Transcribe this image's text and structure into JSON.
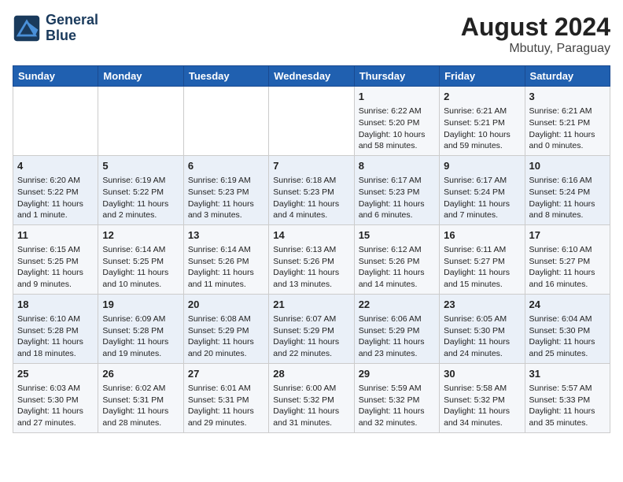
{
  "header": {
    "logo_line1": "General",
    "logo_line2": "Blue",
    "month_year": "August 2024",
    "location": "Mbutuy, Paraguay"
  },
  "days_of_week": [
    "Sunday",
    "Monday",
    "Tuesday",
    "Wednesday",
    "Thursday",
    "Friday",
    "Saturday"
  ],
  "weeks": [
    [
      {
        "day": "",
        "info": ""
      },
      {
        "day": "",
        "info": ""
      },
      {
        "day": "",
        "info": ""
      },
      {
        "day": "",
        "info": ""
      },
      {
        "day": "1",
        "info": "Sunrise: 6:22 AM\nSunset: 5:20 PM\nDaylight: 10 hours\nand 58 minutes."
      },
      {
        "day": "2",
        "info": "Sunrise: 6:21 AM\nSunset: 5:21 PM\nDaylight: 10 hours\nand 59 minutes."
      },
      {
        "day": "3",
        "info": "Sunrise: 6:21 AM\nSunset: 5:21 PM\nDaylight: 11 hours\nand 0 minutes."
      }
    ],
    [
      {
        "day": "4",
        "info": "Sunrise: 6:20 AM\nSunset: 5:22 PM\nDaylight: 11 hours\nand 1 minute."
      },
      {
        "day": "5",
        "info": "Sunrise: 6:19 AM\nSunset: 5:22 PM\nDaylight: 11 hours\nand 2 minutes."
      },
      {
        "day": "6",
        "info": "Sunrise: 6:19 AM\nSunset: 5:23 PM\nDaylight: 11 hours\nand 3 minutes."
      },
      {
        "day": "7",
        "info": "Sunrise: 6:18 AM\nSunset: 5:23 PM\nDaylight: 11 hours\nand 4 minutes."
      },
      {
        "day": "8",
        "info": "Sunrise: 6:17 AM\nSunset: 5:23 PM\nDaylight: 11 hours\nand 6 minutes."
      },
      {
        "day": "9",
        "info": "Sunrise: 6:17 AM\nSunset: 5:24 PM\nDaylight: 11 hours\nand 7 minutes."
      },
      {
        "day": "10",
        "info": "Sunrise: 6:16 AM\nSunset: 5:24 PM\nDaylight: 11 hours\nand 8 minutes."
      }
    ],
    [
      {
        "day": "11",
        "info": "Sunrise: 6:15 AM\nSunset: 5:25 PM\nDaylight: 11 hours\nand 9 minutes."
      },
      {
        "day": "12",
        "info": "Sunrise: 6:14 AM\nSunset: 5:25 PM\nDaylight: 11 hours\nand 10 minutes."
      },
      {
        "day": "13",
        "info": "Sunrise: 6:14 AM\nSunset: 5:26 PM\nDaylight: 11 hours\nand 11 minutes."
      },
      {
        "day": "14",
        "info": "Sunrise: 6:13 AM\nSunset: 5:26 PM\nDaylight: 11 hours\nand 13 minutes."
      },
      {
        "day": "15",
        "info": "Sunrise: 6:12 AM\nSunset: 5:26 PM\nDaylight: 11 hours\nand 14 minutes."
      },
      {
        "day": "16",
        "info": "Sunrise: 6:11 AM\nSunset: 5:27 PM\nDaylight: 11 hours\nand 15 minutes."
      },
      {
        "day": "17",
        "info": "Sunrise: 6:10 AM\nSunset: 5:27 PM\nDaylight: 11 hours\nand 16 minutes."
      }
    ],
    [
      {
        "day": "18",
        "info": "Sunrise: 6:10 AM\nSunset: 5:28 PM\nDaylight: 11 hours\nand 18 minutes."
      },
      {
        "day": "19",
        "info": "Sunrise: 6:09 AM\nSunset: 5:28 PM\nDaylight: 11 hours\nand 19 minutes."
      },
      {
        "day": "20",
        "info": "Sunrise: 6:08 AM\nSunset: 5:29 PM\nDaylight: 11 hours\nand 20 minutes."
      },
      {
        "day": "21",
        "info": "Sunrise: 6:07 AM\nSunset: 5:29 PM\nDaylight: 11 hours\nand 22 minutes."
      },
      {
        "day": "22",
        "info": "Sunrise: 6:06 AM\nSunset: 5:29 PM\nDaylight: 11 hours\nand 23 minutes."
      },
      {
        "day": "23",
        "info": "Sunrise: 6:05 AM\nSunset: 5:30 PM\nDaylight: 11 hours\nand 24 minutes."
      },
      {
        "day": "24",
        "info": "Sunrise: 6:04 AM\nSunset: 5:30 PM\nDaylight: 11 hours\nand 25 minutes."
      }
    ],
    [
      {
        "day": "25",
        "info": "Sunrise: 6:03 AM\nSunset: 5:30 PM\nDaylight: 11 hours\nand 27 minutes."
      },
      {
        "day": "26",
        "info": "Sunrise: 6:02 AM\nSunset: 5:31 PM\nDaylight: 11 hours\nand 28 minutes."
      },
      {
        "day": "27",
        "info": "Sunrise: 6:01 AM\nSunset: 5:31 PM\nDaylight: 11 hours\nand 29 minutes."
      },
      {
        "day": "28",
        "info": "Sunrise: 6:00 AM\nSunset: 5:32 PM\nDaylight: 11 hours\nand 31 minutes."
      },
      {
        "day": "29",
        "info": "Sunrise: 5:59 AM\nSunset: 5:32 PM\nDaylight: 11 hours\nand 32 minutes."
      },
      {
        "day": "30",
        "info": "Sunrise: 5:58 AM\nSunset: 5:32 PM\nDaylight: 11 hours\nand 34 minutes."
      },
      {
        "day": "31",
        "info": "Sunrise: 5:57 AM\nSunset: 5:33 PM\nDaylight: 11 hours\nand 35 minutes."
      }
    ]
  ]
}
